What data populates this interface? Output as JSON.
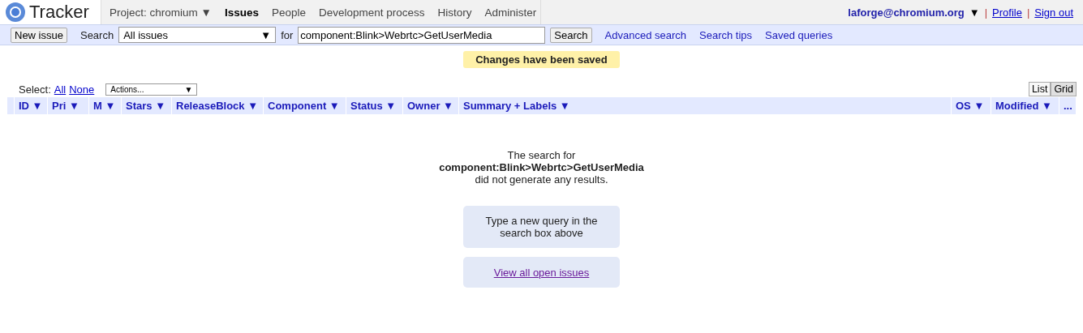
{
  "header": {
    "logo": "Tracker",
    "nav": [
      {
        "label": "Project: chromium ▼",
        "selected": false
      },
      {
        "label": "Issues",
        "selected": true
      },
      {
        "label": "People",
        "selected": false
      },
      {
        "label": "Development process",
        "selected": false
      },
      {
        "label": "History",
        "selected": false
      },
      {
        "label": "Administer",
        "selected": false
      }
    ],
    "user": "laforge@chromium.org",
    "user_caret": "▼",
    "links": [
      {
        "separator": "|",
        "label": "Profile"
      },
      {
        "separator": "|",
        "label": "Sign out"
      }
    ]
  },
  "search_bar": {
    "new_issue": "New issue",
    "search_label": "Search",
    "scope": "All issues",
    "scope_caret": "▼",
    "for_label": "for",
    "query": "component:Blink>Webrtc>GetUserMedia",
    "search_button": "Search",
    "links": [
      "Advanced search",
      "Search tips",
      "Saved queries"
    ]
  },
  "notice": "Changes have been saved",
  "select": {
    "label": "Select:",
    "links": [
      "All",
      "None"
    ],
    "actions": "Actions...",
    "actions_caret": "▼"
  },
  "view_toggle": [
    {
      "label": "List",
      "selected": true
    },
    {
      "label": "Grid",
      "selected": false
    }
  ],
  "table": {
    "columns": [
      "ID ▼",
      "Pri ▼",
      "M ▼",
      "Stars ▼",
      "ReleaseBlock ▼",
      "Component ▼",
      "Status ▼",
      "Owner ▼",
      "Summary + Labels ▼",
      "OS ▼",
      "Modified ▼",
      "..."
    ]
  },
  "empty": {
    "line1": "The search for",
    "query": "component:Blink>Webrtc>GetUserMedia",
    "line3": "did not generate any results.",
    "hint": "Type a new query in the search box above",
    "link": "View all open issues"
  }
}
